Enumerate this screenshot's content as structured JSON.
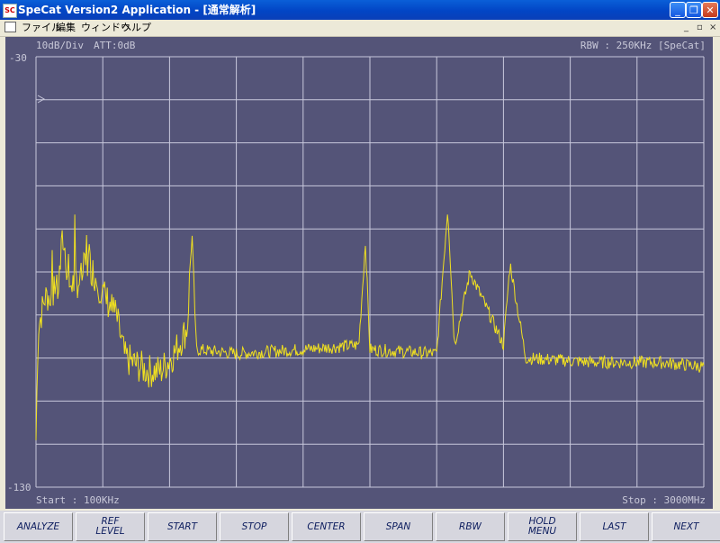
{
  "window": {
    "icon_text": "SC",
    "title": "SpeCat Version2 Application - [通常解析]",
    "controls": [
      "minimize-icon",
      "restore-icon",
      "close-icon"
    ]
  },
  "menu": {
    "items": [
      "ファイル",
      "編集",
      "ウィンドウ",
      "ヘルプ"
    ],
    "mdi_controls": [
      "_",
      "▫",
      "×"
    ]
  },
  "analyzer": {
    "scale_div": "10dB/Div",
    "attenuation": "ATT:0dB",
    "rbw": "RBW : 250KHz [SpeCat]",
    "ref_top": "-30",
    "ref_bottom": "-130",
    "start": "Start : 100KHz",
    "stop": "Stop : 3000MHz",
    "trace_color": "#f0e020",
    "grid_color": "#c8c8dc",
    "background": "#545478"
  },
  "buttons": [
    {
      "id": "analyze",
      "lines": [
        "ANALYZE"
      ]
    },
    {
      "id": "ref-level",
      "lines": [
        "REF",
        "LEVEL"
      ]
    },
    {
      "id": "start",
      "lines": [
        "START"
      ]
    },
    {
      "id": "stop",
      "lines": [
        "STOP"
      ]
    },
    {
      "id": "center",
      "lines": [
        "CENTER"
      ]
    },
    {
      "id": "span",
      "lines": [
        "SPAN"
      ]
    },
    {
      "id": "rbw",
      "lines": [
        "RBW"
      ]
    },
    {
      "id": "hold-menu",
      "lines": [
        "HOLD",
        "MENU"
      ]
    },
    {
      "id": "last",
      "lines": [
        "LAST"
      ]
    },
    {
      "id": "next",
      "lines": [
        "NEXT"
      ]
    }
  ],
  "chart_data": {
    "type": "line",
    "y_range_db": [
      -130,
      -30
    ],
    "x_range_mhz": [
      0.1,
      3000
    ],
    "grid": true,
    "series": [
      {
        "points_mhz_db": [
          [
            0.1,
            -119
          ],
          [
            10,
            -93
          ],
          [
            40,
            -86
          ],
          [
            100,
            -84
          ],
          [
            120,
            -72
          ],
          [
            150,
            -83
          ],
          [
            200,
            -82
          ],
          [
            230,
            -77
          ],
          [
            300,
            -85
          ],
          [
            360,
            -90
          ],
          [
            400,
            -100
          ],
          [
            500,
            -103
          ],
          [
            560,
            -103
          ],
          [
            620,
            -99
          ],
          [
            680,
            -93
          ],
          [
            700,
            -70
          ],
          [
            720,
            -98
          ],
          [
            900,
            -99
          ],
          [
            1200,
            -98
          ],
          [
            1450,
            -97
          ],
          [
            1480,
            -73
          ],
          [
            1500,
            -98
          ],
          [
            1800,
            -99
          ],
          [
            1850,
            -65
          ],
          [
            1880,
            -97
          ],
          [
            1950,
            -80
          ],
          [
            2100,
            -97
          ],
          [
            2130,
            -78
          ],
          [
            2200,
            -100
          ],
          [
            2500,
            -101
          ],
          [
            2800,
            -101
          ],
          [
            3000,
            -102
          ]
        ]
      }
    ]
  }
}
